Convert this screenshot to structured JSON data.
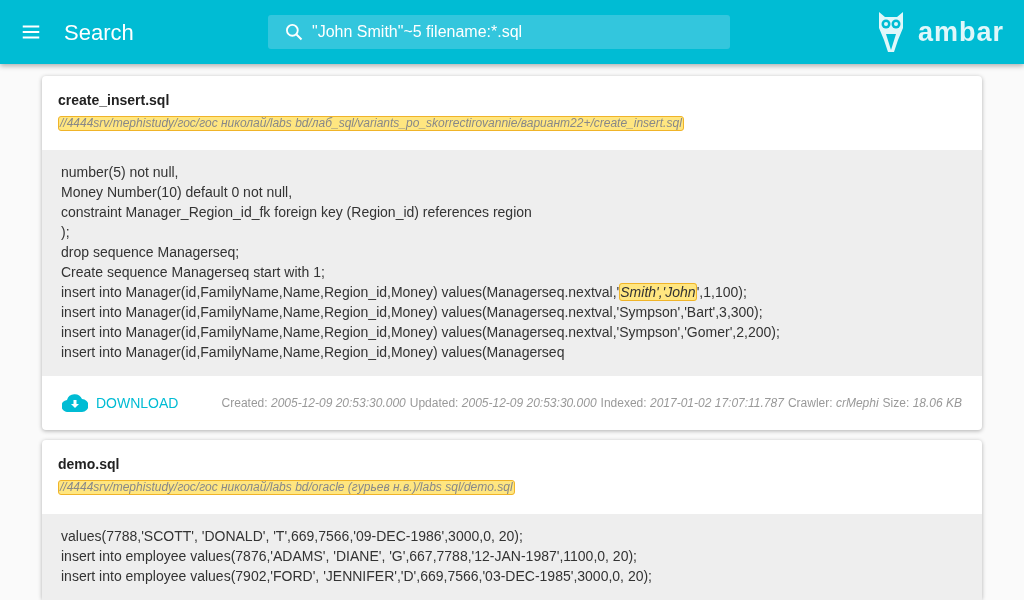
{
  "header": {
    "title": "Search",
    "search": {
      "value": "\"John Smith\"~5 filename:*.sql"
    },
    "logo_text": "ambar"
  },
  "results": [
    {
      "filename": "create_insert.sql",
      "path": "//4444srv/mephistudy/гос/гос николай/labs bd/лаб_sql/variants_po_skorrectirovannie/вариант22+/create_insert.sql",
      "lines": [
        [
          {
            "text": "number(5) not null,",
            "highlighted": false
          }
        ],
        [
          {
            "text": "Money Number(10) default 0 not null,",
            "highlighted": false
          }
        ],
        [
          {
            "text": "constraint Manager_Region_id_fk foreign key (Region_id) references region",
            "highlighted": false
          }
        ],
        [
          {
            "text": ");",
            "highlighted": false
          }
        ],
        [
          {
            "text": "drop sequence Managerseq;",
            "highlighted": false
          }
        ],
        [
          {
            "text": "Create sequence Managerseq start with 1;",
            "highlighted": false
          }
        ],
        [
          {
            "text": "insert into Manager(id,FamilyName,Name,Region_id,Money) values(Managerseq.nextval,'",
            "highlighted": false
          },
          {
            "text": "Smith','John",
            "highlighted": true
          },
          {
            "text": "',1,100);",
            "highlighted": false
          }
        ],
        [
          {
            "text": "insert into Manager(id,FamilyName,Name,Region_id,Money) values(Managerseq.nextval,'Sympson','Bart',3,300);",
            "highlighted": false
          }
        ],
        [
          {
            "text": "insert into Manager(id,FamilyName,Name,Region_id,Money) values(Managerseq.nextval,'Sympson','Gomer',2,200);",
            "highlighted": false
          }
        ],
        [
          {
            "text": "insert into Manager(id,FamilyName,Name,Region_id,Money) values(Managerseq",
            "highlighted": false
          }
        ]
      ],
      "download": "DOWNLOAD",
      "meta": [
        {
          "label": "Created:",
          "value": "2005-12-09 20:53:30.000"
        },
        {
          "label": "Updated:",
          "value": "2005-12-09 20:53:30.000"
        },
        {
          "label": "Indexed:",
          "value": "2017-01-02 17:07:11.787"
        },
        {
          "label": "Crawler:",
          "value": "crMephi"
        },
        {
          "label": "Size:",
          "value": "18.06 KB"
        }
      ]
    },
    {
      "filename": "demo.sql",
      "path": "//4444srv/mephistudy/гос/гос николай/labs bd/oracle (гурьев н.в.)/labs sql/demo.sql",
      "lines": [
        [
          {
            "text": "values(7788,'SCOTT', 'DONALD', 'T',669,7566,'09-DEC-1986',3000,0, 20);",
            "highlighted": false
          }
        ],
        [
          {
            "text": "insert into employee values(7876,'ADAMS', 'DIANE', 'G',667,7788,'12-JAN-1987',1100,0, 20);",
            "highlighted": false
          }
        ],
        [
          {
            "text": "insert into employee values(7902,'FORD', 'JENNIFER','D',669,7566,'03-DEC-1985',3000,0, 20);",
            "highlighted": false
          }
        ]
      ]
    }
  ]
}
